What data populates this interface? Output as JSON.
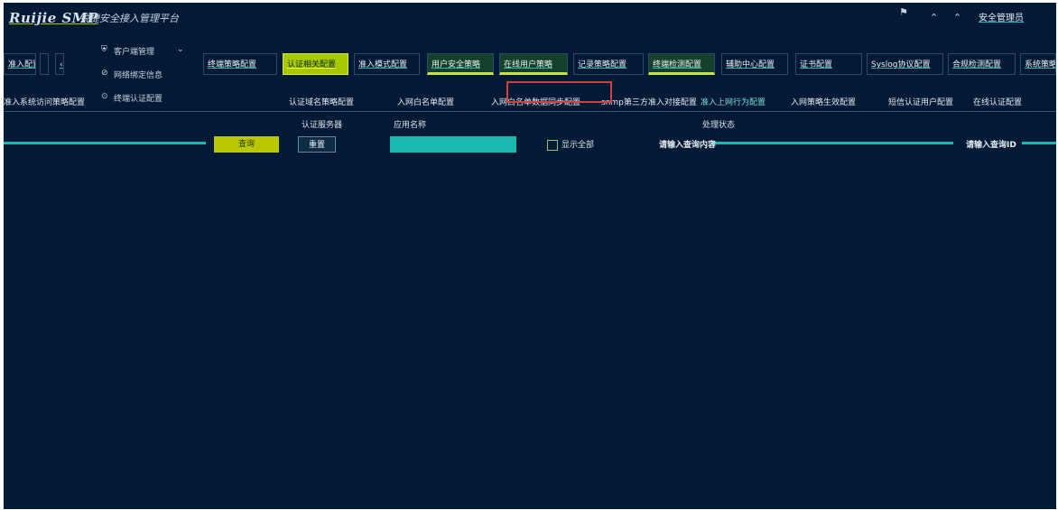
{
  "app": {
    "logo": "Ruijie SMP",
    "brand": "锐捷安全接入管理平台"
  },
  "user": {
    "name": "安全管理员"
  },
  "menu": {
    "title": "客户端管理",
    "items": [
      "网络绑定信息",
      "终端认证配置"
    ]
  },
  "tabs": [
    {
      "label": "准入配置"
    },
    {
      "label": "终端策略配置"
    },
    {
      "label": "认证相关配置"
    },
    {
      "label": "准入模式配置"
    },
    {
      "label": "用户安全策略"
    },
    {
      "label": "在线用户策略"
    },
    {
      "label": "记录策略配置"
    },
    {
      "label": "终端检测配置"
    },
    {
      "label": "辅助中心配置"
    },
    {
      "label": "证书配置"
    },
    {
      "label": "Syslog协议配置"
    },
    {
      "label": "合规检测配置"
    },
    {
      "label": "系统策略"
    }
  ],
  "subtabs": [
    "准入系统访问策略配置",
    "认证域名策略配置",
    "入网白名单配置",
    "入网白名单数据同步配置",
    "snmp第三方准入对接配置",
    "准入上网行为配置",
    "入网策略生效配置",
    "短信认证用户配置",
    "在线认证配置"
  ],
  "filters": {
    "auth_name_label": "认证服务器",
    "resource_label": "应用名称",
    "status_label": "处理状态"
  },
  "buttons": {
    "query": "查询",
    "reset": "重置"
  },
  "checkbox": {
    "label": "显示全部"
  },
  "notes": {
    "left": "请输入查询内容",
    "right": "请输入查询ID"
  }
}
